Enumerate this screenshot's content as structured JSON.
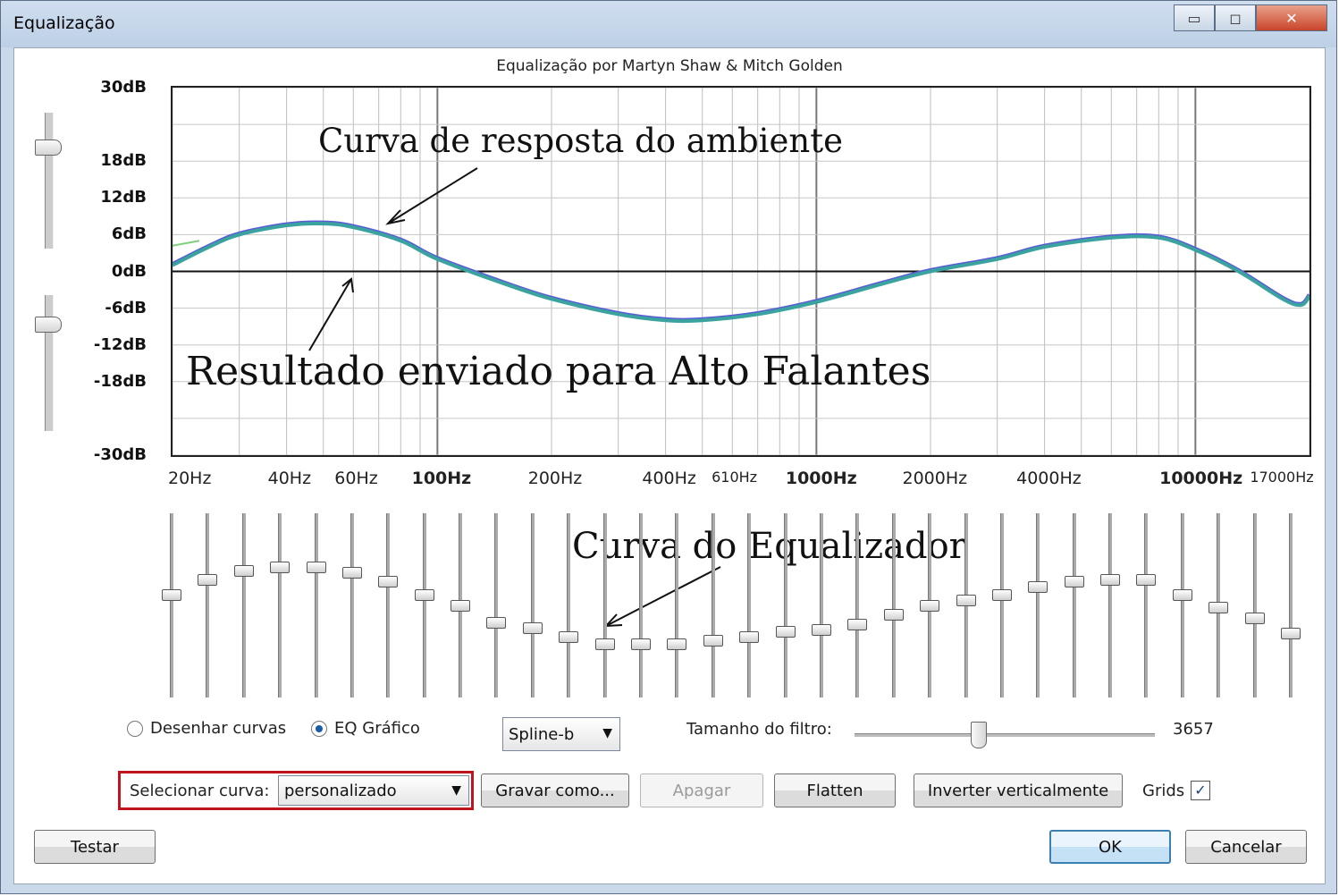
{
  "window": {
    "title": "Equalização",
    "controls": {
      "minimize": "▭",
      "maximize": "◻",
      "close": "✕"
    }
  },
  "graph": {
    "title": "Equalização por Martyn Shaw & Mitch Golden",
    "db_labels": [
      "30dB",
      "18dB",
      "12dB",
      "6dB",
      "0dB",
      "-6dB",
      "-12dB",
      "-18dB",
      "-30dB"
    ],
    "hz_labels": [
      "20Hz",
      "40Hz",
      "60Hz",
      "100Hz",
      "200Hz",
      "400Hz",
      "610Hz",
      "1000Hz",
      "2000Hz",
      "4000Hz",
      "10000Hz",
      "17000Hz"
    ],
    "colors": {
      "room_curve": "#5b5bd6",
      "speaker_curve": "#3aa3a0",
      "accent_green": "#7ed07e"
    }
  },
  "chart_data": {
    "type": "line",
    "title": "Equalização por Martyn Shaw & Mitch Golden",
    "x_scale": "log",
    "xlim": [
      20,
      20000
    ],
    "ylim": [
      -30,
      30
    ],
    "xlabel": "",
    "ylabel": "",
    "grid": true,
    "series": [
      {
        "values": [
          [
            20,
            1
          ],
          [
            25,
            4
          ],
          [
            30,
            6
          ],
          [
            40,
            7.5
          ],
          [
            50,
            7.8
          ],
          [
            60,
            7.2
          ],
          [
            80,
            5
          ],
          [
            100,
            2
          ],
          [
            150,
            -2
          ],
          [
            200,
            -4.5
          ],
          [
            300,
            -7
          ],
          [
            400,
            -8
          ],
          [
            500,
            -8
          ],
          [
            700,
            -7
          ],
          [
            1000,
            -5
          ],
          [
            1500,
            -2
          ],
          [
            2000,
            0
          ],
          [
            3000,
            2
          ],
          [
            4000,
            4
          ],
          [
            6000,
            5.5
          ],
          [
            8000,
            5.5
          ],
          [
            10000,
            3.5
          ],
          [
            13000,
            0
          ],
          [
            17000,
            -4.5
          ],
          [
            19000,
            -5.5
          ],
          [
            20000,
            -4
          ]
        ]
      }
    ]
  },
  "annotations": {
    "room_curve": "Curva de resposta do ambiente",
    "speaker_result": "Resultado enviado para Alto Falantes",
    "eq_curve": "Curva do Equalizador"
  },
  "sliders": {
    "gain_top_level": 0.75,
    "gain_bottom_level": 0.79,
    "bands": [
      0.56,
      0.64,
      0.69,
      0.71,
      0.71,
      0.68,
      0.63,
      0.56,
      0.5,
      0.41,
      0.38,
      0.33,
      0.29,
      0.29,
      0.29,
      0.31,
      0.33,
      0.36,
      0.37,
      0.4,
      0.45,
      0.5,
      0.53,
      0.56,
      0.6,
      0.63,
      0.64,
      0.64,
      0.56,
      0.49,
      0.43,
      0.35
    ]
  },
  "mode": {
    "draw_curves_label": "Desenhar curvas",
    "graphic_eq_label": "EQ Gráfico",
    "selected": "graphic_eq",
    "interpolation": "Spline-b",
    "filter_size_label": "Tamanho do filtro:",
    "filter_size_value": "3657",
    "filter_size_level": 0.41
  },
  "curve_bar": {
    "select_label": "Selecionar curva:",
    "select_value": "personalizado",
    "save_as": "Gravar como...",
    "delete": "Apagar",
    "flatten": "Flatten",
    "invert": "Inverter verticalmente",
    "grids_label": "Grids",
    "grids_checked": true,
    "highlight_color": "#c0141e"
  },
  "footer": {
    "test": "Testar",
    "ok": "OK",
    "cancel": "Cancelar"
  }
}
